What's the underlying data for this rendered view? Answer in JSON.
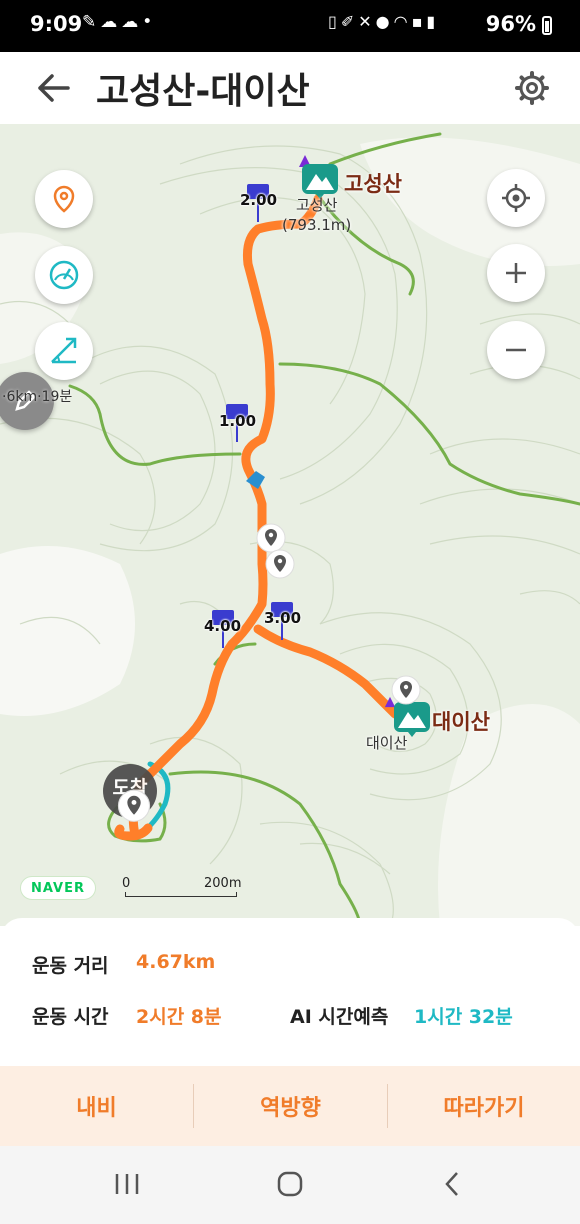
{
  "status_bar": {
    "time": "9:09",
    "battery": "96%",
    "left_icons": [
      "notification-icon",
      "cloud-icon",
      "cloud-icon",
      "dot-icon"
    ],
    "right_icons": [
      "battery-saver-icon",
      "pen-icon",
      "mute-icon",
      "location-icon",
      "wifi-icon",
      "hd-voice-icon",
      "signal-icon"
    ]
  },
  "header": {
    "title": "고성산-대이산",
    "back_icon": "arrow-left-icon",
    "settings_icon": "gear-icon"
  },
  "map": {
    "km_markers": [
      "2.00",
      "1.00",
      "3.00",
      "4.00"
    ],
    "peaks": {
      "goseongsan": {
        "name": "고성산",
        "sub": "고성산",
        "elevation": "(793.1m)"
      },
      "daeisan": {
        "name": "대이산",
        "sub": "대이산"
      }
    },
    "side_label": "·6km·19분",
    "finish_label": "도착",
    "logo": "NAVER",
    "scale": {
      "start": "0",
      "end": "200m"
    },
    "colors": {
      "route": "#ff7f2a",
      "trail": "#6aa84f",
      "accent_teal": "#1fb9c4"
    },
    "left_buttons": [
      "location-pin-icon",
      "speedometer-icon",
      "slope-icon"
    ],
    "right_buttons": [
      "crosshair-icon",
      "zoom-in-icon",
      "zoom-out-icon"
    ]
  },
  "stats": {
    "distance_label": "운동 거리",
    "distance_value": "4.67km",
    "time_label": "운동 시간",
    "time_value": "2시간 8분",
    "ai_label": "AI 시간예측",
    "ai_value": "1시간 32분"
  },
  "actions": {
    "navi": "내비",
    "reverse": "역방향",
    "follow": "따라가기"
  },
  "nav_bar": [
    "recent-apps-icon",
    "home-icon",
    "back-icon"
  ]
}
